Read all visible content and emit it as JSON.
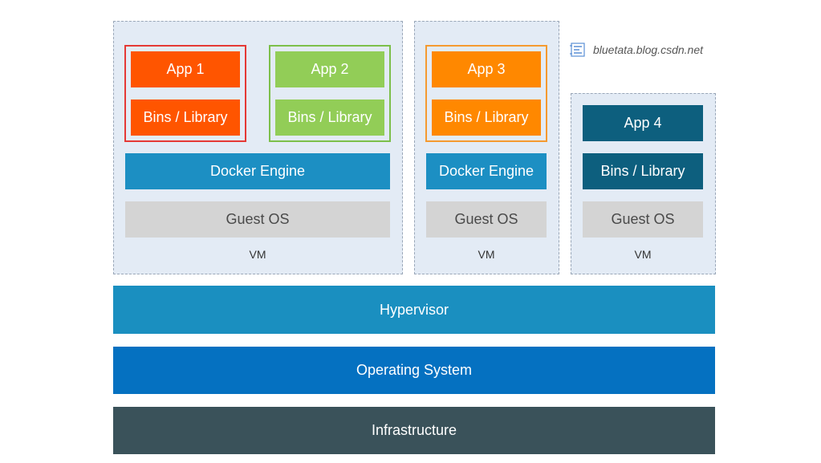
{
  "watermark": {
    "text": "bluetata.blog.csdn.net",
    "icon": "book-icon"
  },
  "vm1": {
    "label": "VM",
    "app1": {
      "name": "App 1",
      "lib": "Bins / Library"
    },
    "app2": {
      "name": "App 2",
      "lib": "Bins / Library"
    },
    "engine": "Docker Engine",
    "guest_os": "Guest OS"
  },
  "vm2": {
    "label": "VM",
    "app3": {
      "name": "App 3",
      "lib": "Bins / Library"
    },
    "engine": "Docker Engine",
    "guest_os": "Guest OS"
  },
  "vm3": {
    "label": "VM",
    "app4": {
      "name": "App 4",
      "lib": "Bins / Library"
    },
    "guest_os": "Guest OS"
  },
  "layers": {
    "hypervisor": "Hypervisor",
    "os": "Operating System",
    "infrastructure": "Infrastructure"
  },
  "colors": {
    "app1": "#ff5500",
    "app1_border": "#e53935",
    "app2": "#92cd57",
    "app2_border": "#7cbf4a",
    "app3": "#ff8800",
    "app3_border": "#f59a30",
    "app4": "#0d5f7e",
    "docker": "#1c8fc3",
    "hypervisor": "#1a8fc0",
    "os": "#0571c1",
    "infrastructure": "#3a525a"
  }
}
